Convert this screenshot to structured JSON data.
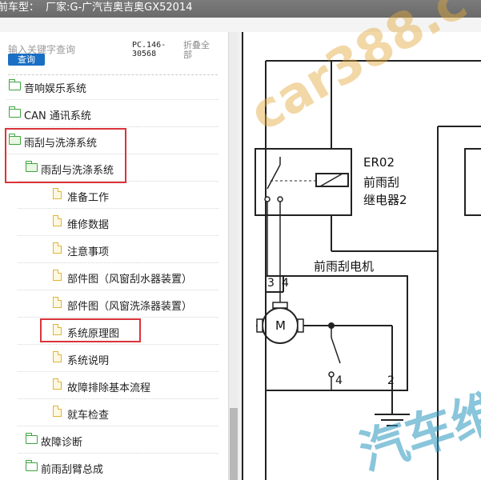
{
  "header": {
    "title_prefix": "前车型：",
    "title_value": "厂家:G-广汽吉奥吉奥GX52014"
  },
  "search": {
    "placeholder": "输入关键字查询",
    "button": "查询",
    "code": "PC.146-30568",
    "collapse": "折叠全部"
  },
  "tree": [
    {
      "label": "音响娱乐系统",
      "icon": "folder-icon"
    },
    {
      "label": "CAN 通讯系统",
      "icon": "folder-icon"
    },
    {
      "label": "雨刮与洗涤系统",
      "icon": "folder-open-icon"
    },
    {
      "label": "雨刮与洗涤系统",
      "icon": "folder-open-icon"
    },
    {
      "label": "准备工作",
      "icon": "document-icon"
    },
    {
      "label": "维修数据",
      "icon": "document-icon"
    },
    {
      "label": "注意事项",
      "icon": "document-icon"
    },
    {
      "label": "部件图（风窗刮水器装置）",
      "icon": "document-icon"
    },
    {
      "label": "部件图（风窗洗涤器装置）",
      "icon": "document-icon"
    },
    {
      "label": "系统原理图",
      "icon": "document-icon"
    },
    {
      "label": "系统说明",
      "icon": "document-icon"
    },
    {
      "label": "故障排除基本流程",
      "icon": "document-icon"
    },
    {
      "label": "就车检查",
      "icon": "document-icon"
    },
    {
      "label": "故障诊断",
      "icon": "folder-icon"
    },
    {
      "label": "前雨刮臂总成",
      "icon": "folder-icon"
    }
  ],
  "diagram": {
    "relay_code": "ER02",
    "relay_name1": "前雨刮",
    "relay_name2": "继电器2",
    "motor_title": "前雨刮电机",
    "pin3": "3",
    "pin4": "4",
    "motor_symbol": "M",
    "pin4b": "4",
    "pin2": "2"
  },
  "watermarks": {
    "wm1": "car388.c",
    "wm2": "汽车维"
  },
  "colors": {
    "highlight": "#d9343a",
    "folder": "#3ea43e",
    "document": "#e0b43a",
    "search_button": "#1a6fc4"
  }
}
